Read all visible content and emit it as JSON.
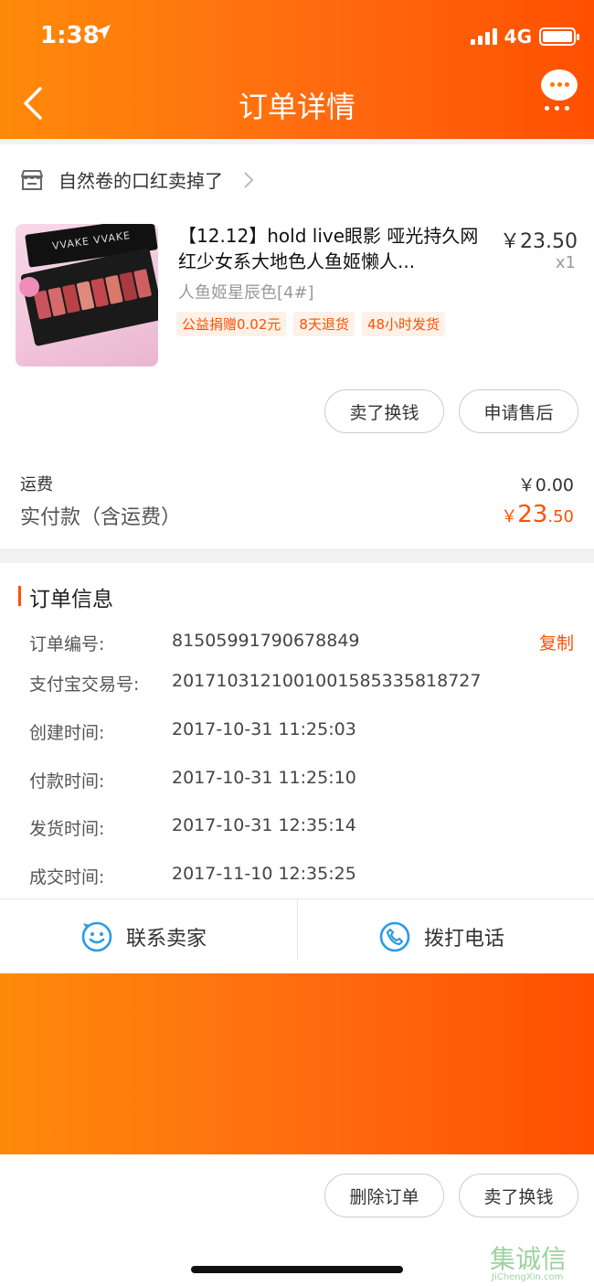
{
  "status_bar": {
    "time": "1:38",
    "network": "4G"
  },
  "nav": {
    "title": "订单详情"
  },
  "store": {
    "name": "自然卷的口红卖掉了"
  },
  "product": {
    "image_palette_brand": "VVAKE VVAKE",
    "title": "【12.12】hold live眼影 哑光持久网红少女系大地色人鱼姬懒人...",
    "price": "￥23.50",
    "quantity": "x1",
    "variant": "人鱼姬星辰色[4#]",
    "tags": [
      "公益捐赠0.02元",
      "8天退货",
      "48小时发货"
    ]
  },
  "item_actions": {
    "sell_label": "卖了换钱",
    "after_sales_label": "申请售后"
  },
  "fees": {
    "shipping_label": "运费",
    "shipping_value": "￥0.00",
    "paid_label": "实付款（含运费）",
    "paid_symbol": "￥",
    "paid_int": "23",
    "paid_dec": ".50"
  },
  "order_info": {
    "title": "订单信息",
    "copy_label": "复制",
    "rows": [
      {
        "label": "订单编号:",
        "value": "81505991790678849"
      },
      {
        "label": "支付宝交易号:",
        "value": "2017103121001001585335818727"
      },
      {
        "label": "创建时间:",
        "value": "2017-10-31 11:25:03"
      },
      {
        "label": "付款时间:",
        "value": "2017-10-31 11:25:10"
      },
      {
        "label": "发货时间:",
        "value": "2017-10-31 12:35:14"
      },
      {
        "label": "成交时间:",
        "value": "2017-11-10 12:35:25"
      }
    ]
  },
  "contact": {
    "seller_label": "联系卖家",
    "phone_label": "拨打电话"
  },
  "bottom_actions": {
    "delete_label": "删除订单",
    "sell_label": "卖了换钱"
  },
  "watermark": {
    "cn": "集诚信",
    "en": "JiChengXin.com"
  },
  "colors": {
    "accent": "#ff5000",
    "header_start": "#ff8a0a",
    "header_end": "#ff5000",
    "icon_blue": "#2a9be8"
  }
}
